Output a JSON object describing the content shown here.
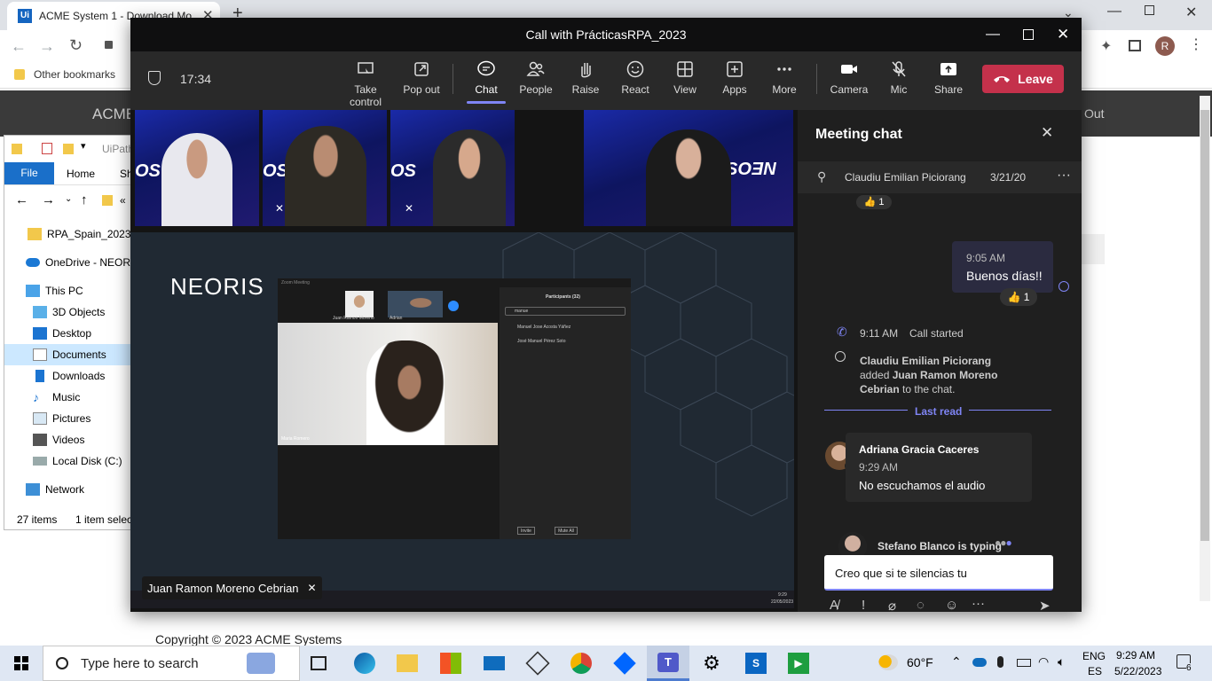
{
  "browser": {
    "tab_title": "ACME System 1 - Download Mo",
    "new_tab": "+",
    "bookmarks_label": "Other bookmarks",
    "profile_initial": "R"
  },
  "acme": {
    "header_left": "ACME",
    "header_right": "Out",
    "copyright": "Copyright © 2023 ACME Systems"
  },
  "explorer": {
    "path_label": "UiPath",
    "tabs": [
      "File",
      "Home",
      "Sh"
    ],
    "address": "«",
    "nav_items": [
      {
        "label": "RPA_Spain_2023 -",
        "icon": "folder-icon"
      },
      {
        "label": "OneDrive - NEORIS",
        "icon": "cloud-icon"
      },
      {
        "label": "This PC",
        "icon": "computer-icon"
      },
      {
        "label": "3D Objects",
        "icon": "cube-icon"
      },
      {
        "label": "Desktop",
        "icon": "desktop-icon"
      },
      {
        "label": "Documents",
        "icon": "document-icon"
      },
      {
        "label": "Downloads",
        "icon": "download-icon"
      },
      {
        "label": "Music",
        "icon": "music-icon"
      },
      {
        "label": "Pictures",
        "icon": "picture-icon"
      },
      {
        "label": "Videos",
        "icon": "video-icon"
      },
      {
        "label": "Local Disk (C:)",
        "icon": "disk-icon"
      },
      {
        "label": "Network",
        "icon": "network-icon"
      }
    ],
    "status_items": "27 items",
    "status_selected": "1 item selec"
  },
  "teams": {
    "window_title": "Call with PrácticasRPA_2023",
    "timer": "17:34",
    "toolbar": {
      "take_control": "Take control",
      "pop_out": "Pop out",
      "chat": "Chat",
      "people": "People",
      "raise": "Raise",
      "react": "React",
      "view": "View",
      "apps": "Apps",
      "more": "More",
      "camera": "Camera",
      "mic": "Mic",
      "share": "Share",
      "leave": "Leave"
    },
    "presenter_name": "Juan Ramon Moreno Cebrian",
    "share": {
      "logo": "NEORIS",
      "zoom_title": "Zoom Meeting",
      "participants_title": "Participants (32)",
      "search_value": "manue",
      "participants": [
        "Manuel Jose Acosta Yáñez",
        "José Manuel Pérez Soto"
      ],
      "self_name": "Maria Romero",
      "thumb1_name": "Juan Ramon Moreno",
      "thumb2_name": "Adrian",
      "invite": "Invite",
      "mute_all": "Mute All",
      "clock_time": "9:29",
      "clock_date": "22/05/2023"
    },
    "chat": {
      "title": "Meeting chat",
      "pinned_name": "Claudiu Emilian Piciorang",
      "pinned_date": "3/21/20",
      "top_reaction_count": "1",
      "self_time": "9:05 AM",
      "self_text": "Buenos días!!",
      "self_reaction_count": "1",
      "call_time": "9:11 AM",
      "call_text": "Call started",
      "added_actor": "Claudiu Emilian Piciorang",
      "added_verb": "added",
      "added_target": "Juan Ramon Moreno Cebrian",
      "added_suffix": "to the chat.",
      "last_read": "Last read",
      "msg_author": "Adriana Gracia Caceres",
      "msg_time": "9:29 AM",
      "msg_text": "No escuchamos el audio",
      "typing": "Stefano Blanco is typing",
      "compose_value": "Creo que si te silencias tu"
    }
  },
  "taskbar": {
    "search_placeholder": "Type here to search",
    "weather": "60°F",
    "lang_top": "ENG",
    "lang_bottom": "ES",
    "time": "9:29 AM",
    "date": "5/22/2023",
    "notifications": "6"
  }
}
